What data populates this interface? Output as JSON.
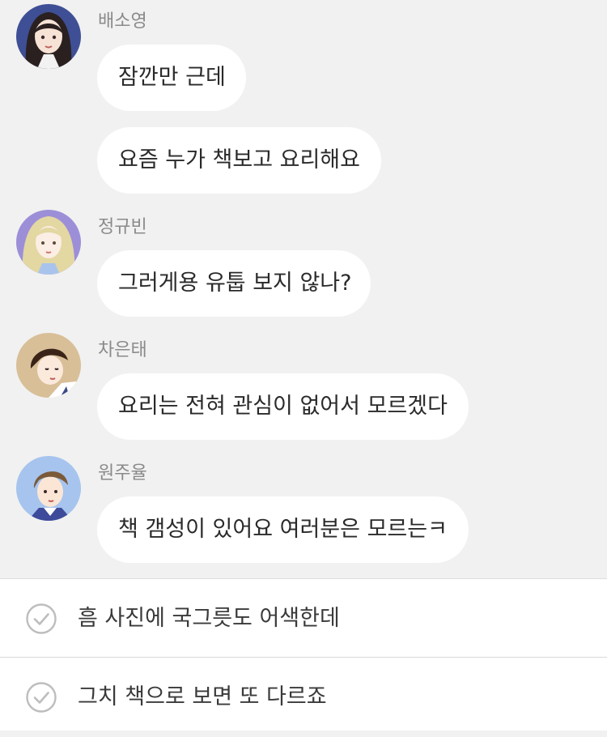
{
  "messages": [
    {
      "sender": "배소영",
      "avatar_icon": "girl-dark-hair-avatar-icon",
      "bubbles": [
        "잠깐만 근데",
        "요즘 누가 책보고 요리해요"
      ]
    },
    {
      "sender": "정규빈",
      "avatar_icon": "girl-blonde-hair-avatar-icon",
      "bubbles": [
        "그러게용 유툽 보지 않나?"
      ]
    },
    {
      "sender": "차은태",
      "avatar_icon": "boy-brown-hair-avatar-icon",
      "bubbles": [
        "요리는 전혀 관심이 없어서 모르겠다"
      ]
    },
    {
      "sender": "원주율",
      "avatar_icon": "boy-light-hair-avatar-icon",
      "bubbles": [
        "책 갬성이 있어요 여러분은 모르는ㅋ"
      ]
    }
  ],
  "choices": [
    {
      "label": "흠 사진에 국그릇도 어색한데",
      "icon": "check-circle-icon"
    },
    {
      "label": "그치 책으로 보면 또 다르죠",
      "icon": "check-circle-icon"
    }
  ],
  "colors": {
    "chat_background": "#f1f1f1",
    "bubble": "#ffffff",
    "sender_name": "#8a8a8a",
    "message_text": "#2a2a2a",
    "check_icon": "#bdbdbd"
  }
}
